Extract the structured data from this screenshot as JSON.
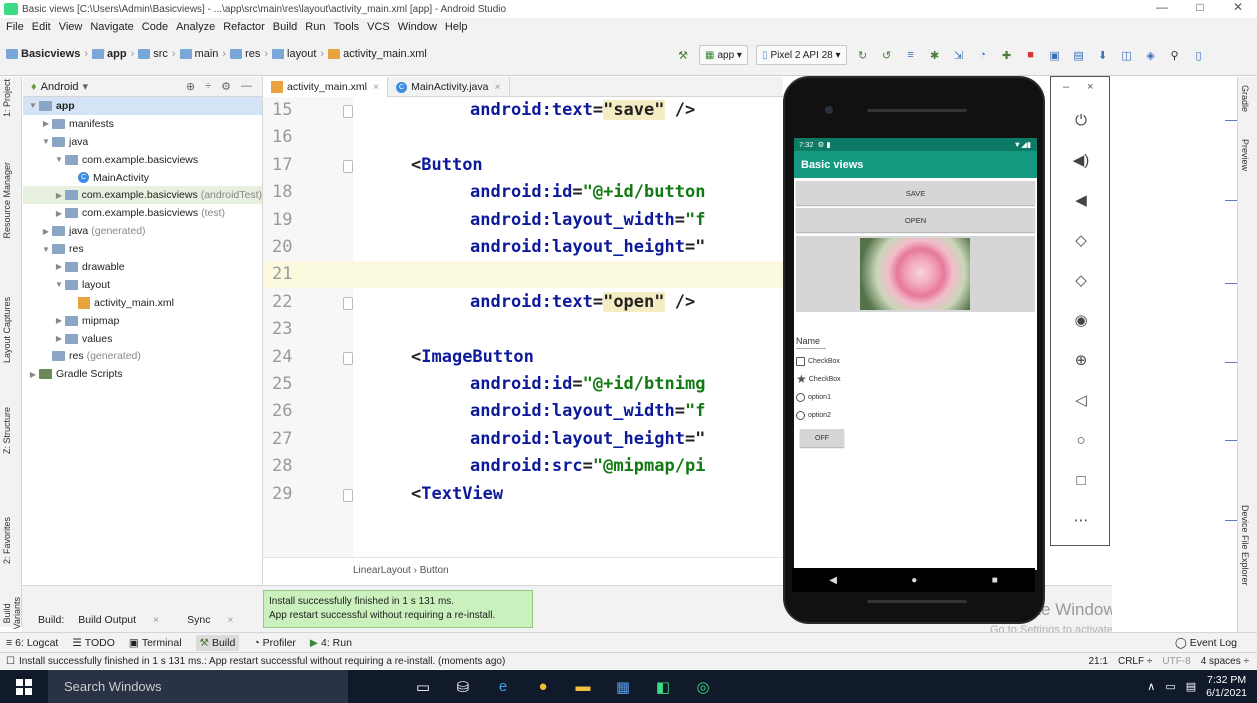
{
  "title": "Basic views [C:\\Users\\Admin\\Basicviews] - ...\\app\\src\\main\\res\\layout\\activity_main.xml [app] - Android Studio",
  "window_controls": {
    "minimize": "—",
    "maximize": "□",
    "close": "✕"
  },
  "menu": [
    "File",
    "Edit",
    "View",
    "Navigate",
    "Code",
    "Analyze",
    "Refactor",
    "Build",
    "Run",
    "Tools",
    "VCS",
    "Window",
    "Help"
  ],
  "breadcrumbs": [
    "Basicviews",
    "app",
    "src",
    "main",
    "res",
    "layout",
    "activity_main.xml"
  ],
  "toolbar": {
    "run_config": "app",
    "device": "Pixel 2 API 28"
  },
  "left_tabs": [
    "1: Project",
    "Resource Manager",
    "Layout Captures",
    "Z: Structure",
    "2: Favorites",
    "Build Variants"
  ],
  "project": {
    "view": "Android",
    "tree": [
      {
        "label": "app",
        "depth": 0,
        "arrow": "▼",
        "icon": "folder",
        "bold": true
      },
      {
        "label": "manifests",
        "depth": 1,
        "arrow": "▶",
        "icon": "folder"
      },
      {
        "label": "java",
        "depth": 1,
        "arrow": "▼",
        "icon": "folder"
      },
      {
        "label": "com.example.basicviews",
        "depth": 2,
        "arrow": "▼",
        "icon": "folder"
      },
      {
        "label": "MainActivity",
        "depth": 3,
        "arrow": "",
        "icon": "class"
      },
      {
        "label": "com.example.basicviews",
        "suffix": "(androidTest)",
        "depth": 2,
        "arrow": "▶",
        "icon": "folder"
      },
      {
        "label": "com.example.basicviews",
        "suffix": "(test)",
        "depth": 2,
        "arrow": "▶",
        "icon": "folder"
      },
      {
        "label": "java",
        "suffix": "(generated)",
        "depth": 1,
        "arrow": "▶",
        "icon": "folder"
      },
      {
        "label": "res",
        "depth": 1,
        "arrow": "▼",
        "icon": "folder"
      },
      {
        "label": "drawable",
        "depth": 2,
        "arrow": "▶",
        "icon": "folder"
      },
      {
        "label": "layout",
        "depth": 2,
        "arrow": "▼",
        "icon": "folder"
      },
      {
        "label": "activity_main.xml",
        "depth": 3,
        "arrow": "",
        "icon": "xml"
      },
      {
        "label": "mipmap",
        "depth": 2,
        "arrow": "▶",
        "icon": "folder"
      },
      {
        "label": "values",
        "depth": 2,
        "arrow": "▶",
        "icon": "folder"
      },
      {
        "label": "res",
        "suffix": "(generated)",
        "depth": 1,
        "arrow": "",
        "icon": "folder"
      },
      {
        "label": "Gradle Scripts",
        "depth": 0,
        "arrow": "▶",
        "icon": "gradle"
      }
    ]
  },
  "editor_tabs": [
    "activity_main.xml",
    "MainActivity.java"
  ],
  "code_lines": [
    {
      "n": "15",
      "parts": [
        [
          "attr",
          "android:text"
        ],
        [
          "plain",
          "="
        ],
        [
          "hlv",
          "\"save\""
        ],
        [
          "plain",
          " />"
        ]
      ]
    },
    {
      "n": "16",
      "parts": []
    },
    {
      "n": "17",
      "parts": [
        [
          "plain",
          "<"
        ],
        [
          "tag",
          "Button"
        ]
      ]
    },
    {
      "n": "18",
      "parts": [
        [
          "attr",
          "android:id"
        ],
        [
          "plain",
          "="
        ],
        [
          "val",
          "\"@+id/button"
        ]
      ]
    },
    {
      "n": "19",
      "parts": [
        [
          "attr",
          "android:layout_width"
        ],
        [
          "plain",
          "="
        ],
        [
          "val",
          "\"f"
        ]
      ]
    },
    {
      "n": "20",
      "parts": [
        [
          "attr",
          "android:layout_height"
        ],
        [
          "plain",
          "=\""
        ]
      ]
    },
    {
      "n": "21",
      "parts": [],
      "highlight": true
    },
    {
      "n": "22",
      "parts": [
        [
          "attr",
          "android:text"
        ],
        [
          "plain",
          "="
        ],
        [
          "hlv",
          "\"open\""
        ],
        [
          "plain",
          " />"
        ]
      ]
    },
    {
      "n": "23",
      "parts": []
    },
    {
      "n": "24",
      "parts": [
        [
          "plain",
          "<"
        ],
        [
          "tag",
          "ImageButton"
        ]
      ]
    },
    {
      "n": "25",
      "parts": [
        [
          "attr",
          "android:id"
        ],
        [
          "plain",
          "="
        ],
        [
          "val",
          "\"@+id/btnimg"
        ]
      ]
    },
    {
      "n": "26",
      "parts": [
        [
          "attr",
          "android:layout_width"
        ],
        [
          "plain",
          "="
        ],
        [
          "val",
          "\"f"
        ]
      ]
    },
    {
      "n": "27",
      "parts": [
        [
          "attr",
          "android:layout_height"
        ],
        [
          "plain",
          "=\""
        ]
      ]
    },
    {
      "n": "28",
      "parts": [
        [
          "attr",
          "android:src"
        ],
        [
          "plain",
          "="
        ],
        [
          "val",
          "\"@mipmap/pi"
        ]
      ]
    },
    {
      "n": "29",
      "parts": [
        [
          "plain",
          "<"
        ],
        [
          "tag",
          "TextView"
        ]
      ]
    }
  ],
  "editor_crumbs": "LinearLayout  ›  Button",
  "build": {
    "label": "Build:",
    "tab": "Build Output",
    "sync": "Sync"
  },
  "toast": {
    "line1": "Install successfully finished in 1 s 131 ms.",
    "line2": "App restart successful without requiring a re-install."
  },
  "tool_tabs": [
    "6: Logcat",
    "TODO",
    "Terminal",
    "Build",
    "Profiler",
    "4: Run"
  ],
  "event_log": "Event Log",
  "status": {
    "message": "Install successfully finished in 1 s 131 ms.: App restart successful without requiring a re-install. (moments ago)",
    "pos": "21:1",
    "crlf": "CRLF ÷",
    "enc": "UTF-8",
    "indent": "4 spaces ÷"
  },
  "right_tabs": [
    "Gradle",
    "Preview",
    "Device File Explorer"
  ],
  "activate": {
    "title": "Activate Windows",
    "sub": "Go to Settings to activate Windows."
  },
  "taskbar": {
    "search": "Search Windows",
    "time": "7:32 PM",
    "date": "6/1/2021"
  },
  "phone": {
    "status_time": "7:32",
    "app_title": "Basic views",
    "btn_save": "SAVE",
    "btn_open": "OPEN",
    "name_label": "Name",
    "check1": "CheckBox",
    "check2": "CheckBox",
    "radio1": "option1",
    "radio2": "option2",
    "toggle": "OFF"
  },
  "emulator_controls": [
    "power",
    "volume-up",
    "volume-down",
    "rotate-left",
    "rotate-right",
    "camera",
    "zoom",
    "back",
    "home",
    "overview",
    "more"
  ]
}
